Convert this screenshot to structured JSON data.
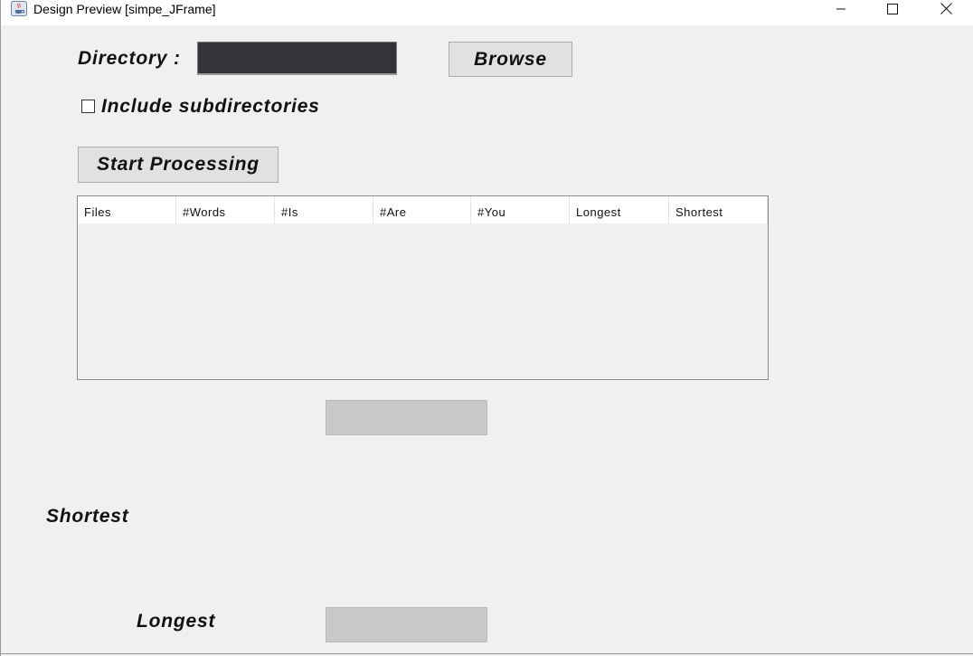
{
  "window": {
    "title": "Design Preview [simpe_JFrame]"
  },
  "form": {
    "directory_label": "Directory :",
    "directory_value": "",
    "browse_label": "Browse",
    "include_subdirs_label": "Include subdirectories",
    "include_subdirs_checked": false,
    "start_label": "Start Processing"
  },
  "table": {
    "columns": [
      "Files",
      "#Words",
      "#Is",
      "#Are",
      "#You",
      "Longest",
      "Shortest"
    ],
    "rows": []
  },
  "results": {
    "shortest_label": "Shortest",
    "longest_label": "Longest",
    "shortest_value": "",
    "longest_value": ""
  },
  "colors": {
    "background": "#f0f0f0",
    "directory_field": "#333338",
    "button": "#e1e1e1",
    "result_box": "#c8c8c8"
  }
}
